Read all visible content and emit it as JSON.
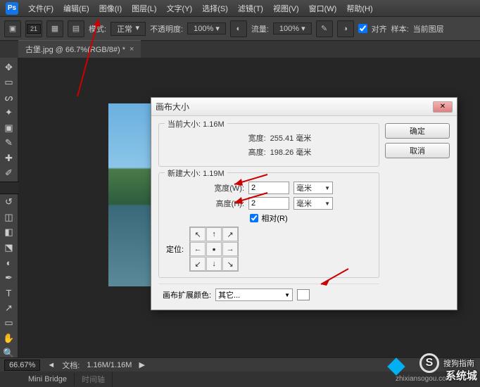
{
  "menu": [
    "文件(F)",
    "编辑(E)",
    "图像(I)",
    "图层(L)",
    "文字(Y)",
    "选择(S)",
    "滤镜(T)",
    "视图(V)",
    "窗口(W)",
    "帮助(H)"
  ],
  "options": {
    "brush_size": "21",
    "mode_label": "模式:",
    "mode_value": "正常",
    "opacity_label": "不透明度:",
    "opacity_value": "100%",
    "flow_label": "流量:",
    "flow_value": "100%",
    "align_label": "对齐",
    "sample_label": "样本:",
    "sample_value": "当前图层"
  },
  "doc_tab": "古堡.jpg @ 66.7%(RGB/8#) *",
  "dialog": {
    "title": "画布大小",
    "ok": "确定",
    "cancel": "取消",
    "current_legend": "当前大小: 1.16M",
    "cur_w_label": "宽度:",
    "cur_w_value": "255.41 毫米",
    "cur_h_label": "高度:",
    "cur_h_value": "198.26 毫米",
    "new_legend": "新建大小: 1.19M",
    "new_w_label": "宽度(W):",
    "new_w_value": "2",
    "new_h_label": "高度(H):",
    "new_h_value": "2",
    "unit": "毫米",
    "relative": "相对(R)",
    "anchor_label": "定位:",
    "ext_label": "画布扩展颜色:",
    "ext_value": "其它..."
  },
  "status": {
    "zoom": "66.67%",
    "doc_label": "文档:",
    "doc_value": "1.16M/1.16M"
  },
  "panels": [
    "Mini Bridge",
    "时间轴"
  ],
  "watermark": {
    "brand": "搜狗指南",
    "url": "zhixiansogou.com",
    "brand2": "系统城"
  }
}
